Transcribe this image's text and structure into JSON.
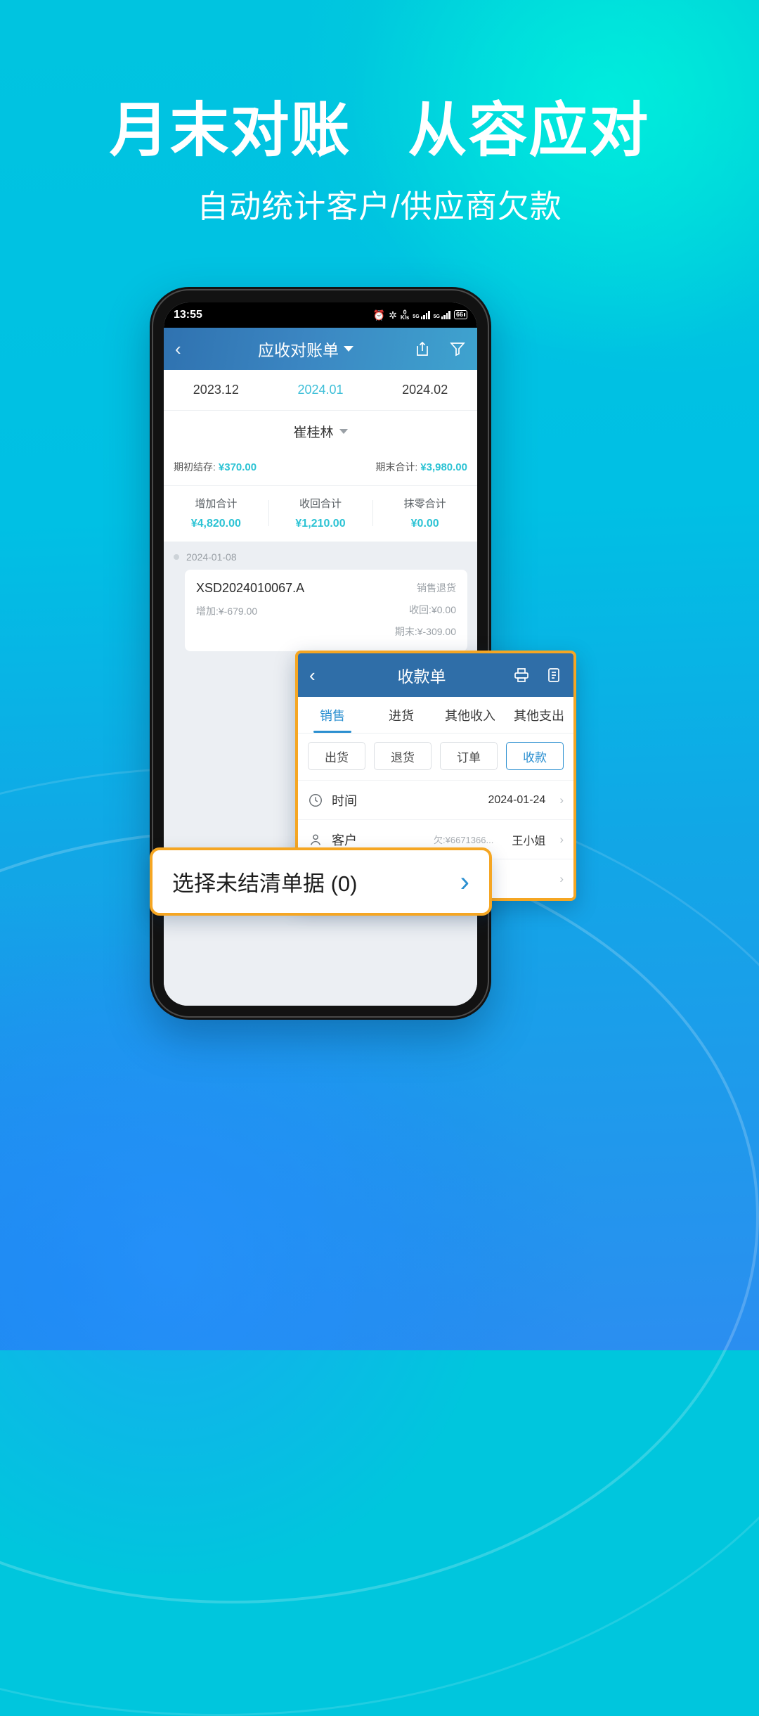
{
  "promo": {
    "headline_left": "月末对账",
    "headline_right": "从容应对",
    "subhead": "自动统计客户/供应商欠款"
  },
  "phone": {
    "status_bar": {
      "time": "13:55",
      "alarm_icon": "alarm-icon",
      "bluetooth_icon": "bluetooth-icon",
      "net_speed_value": "0",
      "net_speed_unit": "K/s",
      "signal_1_label": "5G",
      "signal_2_label": "5G",
      "battery": "66"
    },
    "app_header": {
      "back_icon": "chevron-left-icon",
      "title": "应收对账单",
      "share_icon": "share-icon",
      "filter_icon": "filter-icon"
    },
    "month_tabs": [
      {
        "label": "2023.12",
        "active": false
      },
      {
        "label": "2024.01",
        "active": true
      },
      {
        "label": "2024.02",
        "active": false
      }
    ],
    "customer": "崔桂林",
    "balance": {
      "open_label": "期初结存:",
      "open_value": "¥370.00",
      "close_label": "期末合计:",
      "close_value": "¥3,980.00"
    },
    "totals": [
      {
        "label": "增加合计",
        "value": "¥4,820.00"
      },
      {
        "label": "收回合计",
        "value": "¥1,210.00"
      },
      {
        "label": "抹零合计",
        "value": "¥0.00"
      }
    ],
    "list": {
      "date": "2024-01-08",
      "doc_no": "XSD2024010067.A",
      "increase": "增加:¥-679.00",
      "type": "销售退货",
      "collected": "收回:¥0.00",
      "ending": "期末:¥-309.00"
    }
  },
  "receipt_panel": {
    "back_icon": "chevron-left-icon",
    "title": "收款单",
    "print_icon": "printer-icon",
    "list_icon": "clipboard-icon",
    "tabs": [
      {
        "label": "销售",
        "active": true
      },
      {
        "label": "进货",
        "active": false
      },
      {
        "label": "其他收入",
        "active": false
      },
      {
        "label": "其他支出",
        "active": false
      }
    ],
    "chips": [
      {
        "label": "出货",
        "active": false
      },
      {
        "label": "退货",
        "active": false
      },
      {
        "label": "订单",
        "active": false
      },
      {
        "label": "收款",
        "active": true
      }
    ],
    "fields": [
      {
        "icon": "clock-icon",
        "label": "时间",
        "hint": "",
        "value": "2024-01-24",
        "chevron": "›"
      },
      {
        "icon": "user-icon",
        "label": "客户",
        "hint": "欠:¥6671366...",
        "value": "王小姐",
        "chevron": "›"
      }
    ],
    "partial_row_chevron": "›"
  },
  "cta": {
    "text": "选择未结清单据 (0)",
    "arrow": "›",
    "accent_color": "#f5a623"
  },
  "colors": {
    "bg_cyan": "#00c4e0",
    "bg_blue": "#2b8ef0",
    "teal_value": "#2cc3d4",
    "header_blue": "#3b86c2",
    "panel_blue": "#2f6ea8",
    "tab_active": "#2b8fd0"
  }
}
